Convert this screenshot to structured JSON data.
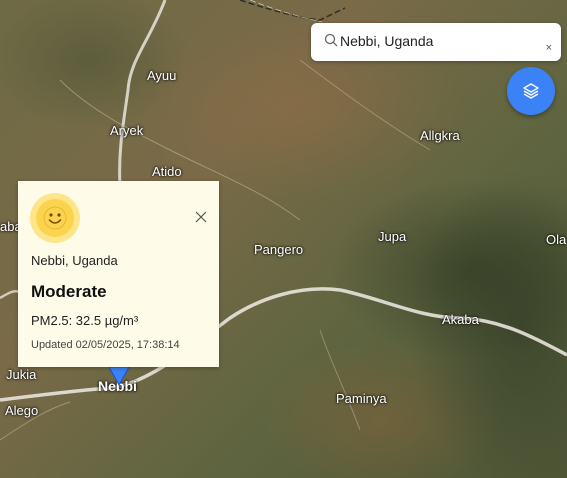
{
  "search": {
    "value": "Nebbi, Uganda",
    "clear_label": "×"
  },
  "layers_button": {
    "icon": "layers-icon",
    "color": "#3b82f6"
  },
  "popup": {
    "icon": "smiley-face-icon",
    "location": "Nebbi, Uganda",
    "level": "Moderate",
    "pm25": "PM2.5: 32.5 µg/m³",
    "updated": "Updated 02/05/2025, 17:38:14",
    "background": "#fefce8"
  },
  "map": {
    "places": {
      "ayuu": "Ayuu",
      "aryek": "Aryek",
      "atido": "Atido",
      "allgkra": "Allgkra",
      "pangero": "Pangero",
      "jupa": "Jupa",
      "ola": "Ola",
      "akaba": "Akaba",
      "jukia": "Jukia",
      "nebbi": "Nebbi",
      "alego": "Alego",
      "paminya": "Paminya",
      "aba": "aba"
    },
    "marker_color": "#3b82f6"
  }
}
